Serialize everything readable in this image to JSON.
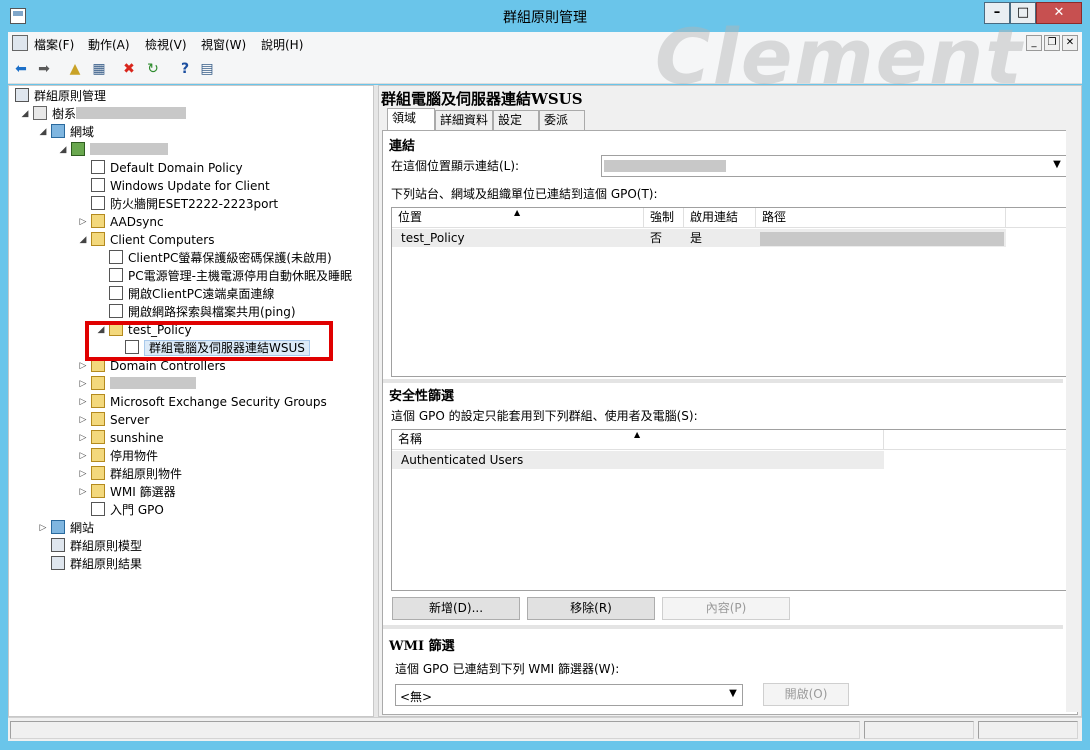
{
  "window": {
    "title": "群組原則管理"
  },
  "caption_buttons": {
    "minimize": "–",
    "maximize": "□",
    "close": "✕"
  },
  "menu": {
    "file": "檔案(F)",
    "action": "動作(A)",
    "view": "檢視(V)",
    "window": "視窗(W)",
    "help": "說明(H)"
  },
  "watermark": "Clement",
  "tree": {
    "root": "群組原則管理",
    "forest": "樹系",
    "domains": "網域",
    "items": {
      "default_domain_policy": "Default Domain Policy",
      "windows_update": "Windows Update for Client",
      "firewall_eset": "防火牆開ESET2222-2223port",
      "aadsync": "AADsync",
      "client_computers": "Client Computers",
      "cc_screensaver": "ClientPC螢幕保護級密碼保護(未啟用)",
      "cc_power": "PC電源管理-主機電源停用自動休眠及睡眠",
      "cc_remote_desktop": "開啟ClientPC遠端桌面連線",
      "cc_network": "開啟網路探索與檔案共用(ping)",
      "test_policy": "test_Policy",
      "wsus_link": "群組電腦及伺服器連結WSUS",
      "domain_controllers": "Domain Controllers",
      "exchange_groups": "Microsoft Exchange Security Groups",
      "server": "Server",
      "sunshine": "sunshine",
      "disabled_objects": "停用物件",
      "gpo_objects": "群組原則物件",
      "wmi_filters": "WMI 篩選器",
      "starter_gpo": "入門 GPO"
    },
    "sites": "網站",
    "modeling": "群組原則模型",
    "results": "群組原則結果"
  },
  "right": {
    "title": "群組電腦及伺服器連結WSUS",
    "tabs": [
      "領域",
      "詳細資料",
      "設定",
      "委派"
    ],
    "links": {
      "section": "連結",
      "show_links_label": "在這個位置顯示連結(L):",
      "linked_label": "下列站台、網域及組織單位已連結到這個 GPO(T):",
      "columns": [
        "位置",
        "強制",
        "啟用連結",
        "路徑"
      ],
      "rows": [
        {
          "location": "test_Policy",
          "enforced": "否",
          "enabled": "是"
        }
      ]
    },
    "security": {
      "section": "安全性篩選",
      "desc": "這個 GPO 的設定只能套用到下列群組、使用者及電腦(S):",
      "columns": [
        "名稱"
      ],
      "rows": [
        {
          "name": "Authenticated Users"
        }
      ],
      "add": "新增(D)...",
      "remove": "移除(R)",
      "properties": "內容(P)"
    },
    "wmi": {
      "section": "WMI 篩選",
      "desc": "這個 GPO 已連結到下列 WMI 篩選器(W):",
      "value": "<無>",
      "open": "開啟(O)"
    }
  }
}
